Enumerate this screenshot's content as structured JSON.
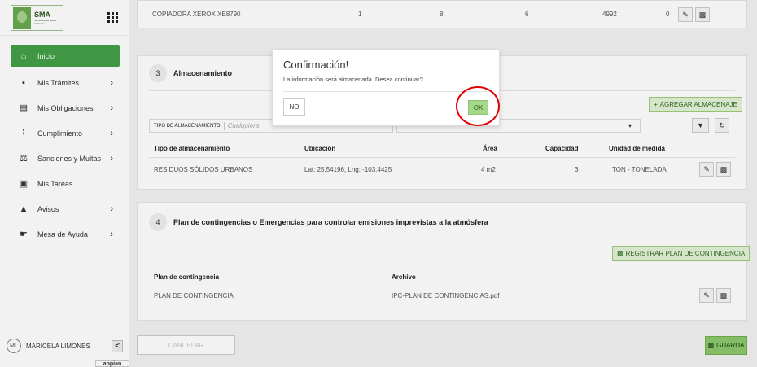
{
  "sidebar": {
    "logo": {
      "title": "SMA",
      "subtitle": "Secretaría de Medio Ambiente"
    },
    "items": [
      {
        "label": "Inicio",
        "icon": "home-icon",
        "has_chevron": false,
        "active": true
      },
      {
        "label": "Mis Trámites",
        "icon": "document-icon",
        "has_chevron": true
      },
      {
        "label": "Mis Obligaciones",
        "icon": "institution-icon",
        "has_chevron": true
      },
      {
        "label": "Cumplimiento",
        "icon": "compliance-icon",
        "has_chevron": true
      },
      {
        "label": "Sanciones y Multas",
        "icon": "sanctions-icon",
        "has_chevron": true
      },
      {
        "label": "Mis Tareas",
        "icon": "briefcase-icon",
        "has_chevron": false
      },
      {
        "label": "Avisos",
        "icon": "warning-icon",
        "has_chevron": true
      },
      {
        "label": "Mesa de Ayuda",
        "icon": "handshake-icon",
        "has_chevron": true
      }
    ],
    "user": {
      "initials": "ML",
      "name": "MARICELA LIMONES",
      "collapse": "<"
    },
    "branding": "appian"
  },
  "top_row": {
    "name": "COPIADORA XEROX XE8790",
    "col2": "1",
    "col3": "8",
    "col4": "6",
    "col5": "4992",
    "col6": "0"
  },
  "section3": {
    "number": "3",
    "title": "Almacenamiento",
    "add_button": "AGREGAR ALMACENAJE",
    "filter1_label": "TIPO DE ALMACENAMIENTO",
    "filter1_placeholder": "Cualquiera",
    "columns": [
      "Tipo de almacenamiento",
      "Ubicación",
      "Área",
      "Capacidad",
      "Unidad de medida"
    ],
    "rows": [
      {
        "tipo": "RESIDUOS SÓLIDOS URBANOS",
        "ubicacion": "Lat: 25.54196, Lng: -103.4425",
        "area": "4 m2",
        "capacidad": "3",
        "unidad": "TON - TONELADA"
      }
    ]
  },
  "section4": {
    "number": "4",
    "title": "Plan de contingencias o Emergencias para controlar emisiones imprevistas a la atmósfera",
    "register_button": "REGISTRAR PLAN DE CONTINGENCIA",
    "columns": [
      "Plan de contingencia",
      "Archivo"
    ],
    "rows": [
      {
        "plan": "PLAN DE CONTINGENCIA",
        "archivo": "IPC-PLAN DE CONTINGENCIAS.pdf"
      }
    ]
  },
  "modal": {
    "title": "Confirmación!",
    "message": "La información será almacenada. Desea continuar?",
    "no_label": "NO",
    "ok_label": "OK"
  },
  "footer": {
    "cancel_label": "CANCELAR",
    "save_label": "GUARDA"
  },
  "colors": {
    "accent_green": "#43a047",
    "ok_green": "#a5d98a",
    "highlight_red": "#e10000"
  }
}
